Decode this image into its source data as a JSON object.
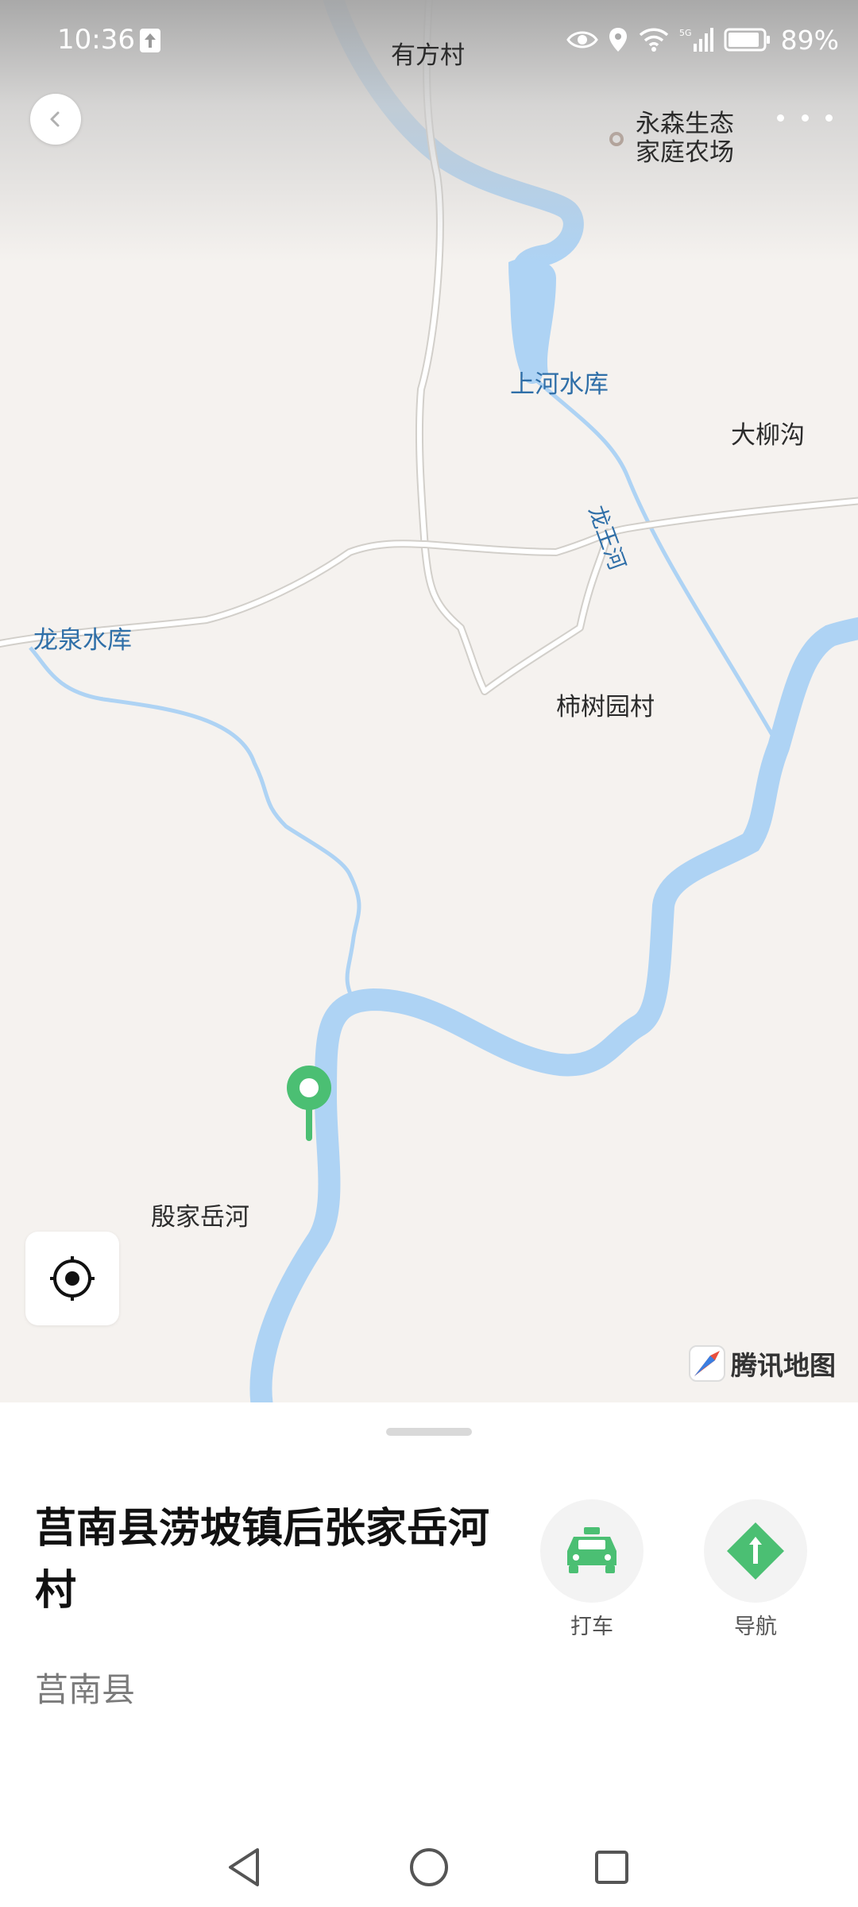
{
  "status_bar": {
    "time": "10:36",
    "battery": "89%",
    "icons": [
      "upload-icon",
      "eye-icon",
      "location-pin-icon",
      "wifi-icon",
      "5g-icon",
      "signal-icon",
      "battery-icon"
    ]
  },
  "map": {
    "labels": [
      {
        "name": "label-youfangcun",
        "text": "有方村",
        "kind": "place"
      },
      {
        "name": "label-yongsen-farm",
        "text": "永森生态\n家庭农场",
        "kind": "poi"
      },
      {
        "name": "label-shanghe-reservoir",
        "text": "上河水库",
        "kind": "water"
      },
      {
        "name": "label-daliugou",
        "text": "大柳沟",
        "kind": "place"
      },
      {
        "name": "label-longwanghe",
        "text": "龙王河",
        "kind": "water"
      },
      {
        "name": "label-longquan-reservoir",
        "text": "龙泉水库",
        "kind": "water"
      },
      {
        "name": "label-shishuyuan",
        "text": "柿树园村",
        "kind": "place"
      },
      {
        "name": "label-yinjiayuehe",
        "text": "殷家岳河",
        "kind": "place"
      }
    ],
    "brand": "腾讯地图",
    "colors": {
      "land": "#f5f2ef",
      "river": "#aed3f4",
      "road": "#ffffff",
      "marker": "#4bbf73"
    }
  },
  "sheet": {
    "title": "莒南县涝坡镇后张家岳河村",
    "subtitle": "莒南县",
    "actions": [
      {
        "label": "打车",
        "icon": "taxi-icon"
      },
      {
        "label": "导航",
        "icon": "navigation-icon"
      }
    ]
  },
  "system_nav": [
    "back-triangle-icon",
    "home-circle-icon",
    "recents-square-icon"
  ]
}
